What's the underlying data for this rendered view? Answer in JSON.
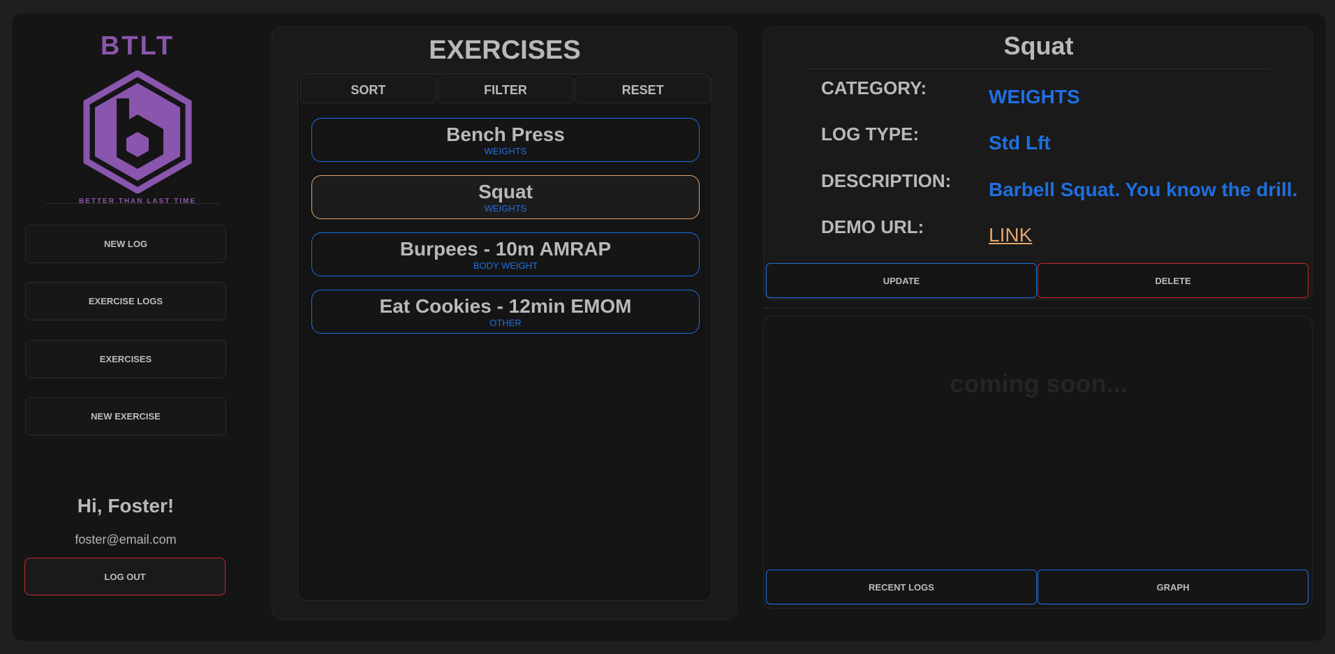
{
  "app": {
    "logo_text": "BTLT",
    "tagline": "BETTER THAN LAST TIME",
    "brand_color": "#8a56ad",
    "accent_color": "#1f6fe0",
    "danger_color": "#c8282e",
    "highlight_color": "#e0a66a"
  },
  "sidebar": {
    "nav": [
      {
        "label": "NEW LOG"
      },
      {
        "label": "EXERCISE LOGS"
      },
      {
        "label": "EXERCISES"
      },
      {
        "label": "NEW EXERCISE"
      }
    ],
    "greeting": "Hi, Foster!",
    "email": "foster@email.com",
    "logout_label": "LOG OUT"
  },
  "exercises": {
    "title": "EXERCISES",
    "tools": {
      "sort": "SORT",
      "filter": "FILTER",
      "reset": "RESET"
    },
    "items": [
      {
        "name": "Bench Press",
        "category": "WEIGHTS",
        "selected": false
      },
      {
        "name": "Squat",
        "category": "WEIGHTS",
        "selected": true
      },
      {
        "name": "Burpees - 10m AMRAP",
        "category": "BODY WEIGHT",
        "selected": false
      },
      {
        "name": "Eat Cookies - 12min EMOM",
        "category": "OTHER",
        "selected": false
      }
    ]
  },
  "detail": {
    "title": "Squat",
    "fields": {
      "category_label": "CATEGORY:",
      "category_value": "WEIGHTS",
      "logtype_label": "LOG TYPE:",
      "logtype_value": "Std Lft",
      "description_label": "DESCRIPTION:",
      "description_value": "Barbell Squat. You know the drill.",
      "demo_label": "DEMO URL:",
      "demo_link": "LINK"
    },
    "update_label": "UPDATE",
    "delete_label": "DELETE"
  },
  "lower": {
    "placeholder": "coming soon...",
    "recent_label": "RECENT LOGS",
    "graph_label": "GRAPH"
  }
}
